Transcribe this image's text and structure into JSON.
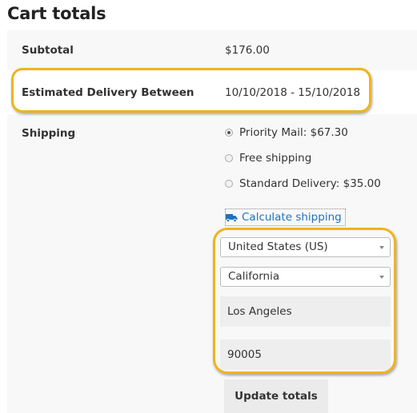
{
  "page": {
    "title": "Cart totals"
  },
  "totals": {
    "subtotal_label": "Subtotal",
    "subtotal_value": "$176.00",
    "delivery_label": "Estimated Delivery Between",
    "delivery_value": "10/10/2018 - 15/10/2018",
    "shipping_label": "Shipping"
  },
  "shipping": {
    "options": [
      {
        "label": "Priority Mail: $67.30",
        "selected": true
      },
      {
        "label": "Free shipping",
        "selected": false
      },
      {
        "label": "Standard Delivery: $35.00",
        "selected": false
      }
    ],
    "calculate_label": "Calculate shipping",
    "calculate_icon": "truck-icon",
    "country": "United States (US)",
    "state": "California",
    "city": "Los Angeles",
    "postcode": "90005",
    "update_label": "Update totals"
  },
  "colors": {
    "highlight": "#f0b41a",
    "link": "#1e73be",
    "row_alt": "#f8f8f8"
  }
}
